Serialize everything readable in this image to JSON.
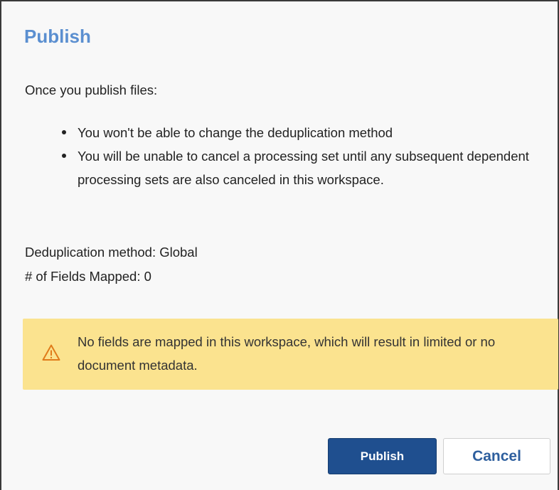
{
  "dialog": {
    "title": "Publish",
    "intro": "Once you publish files:",
    "bullets": [
      "You won't be able to change the deduplication method",
      "You will be unable to cancel a processing set until any subsequent dependent processing sets are also canceled in this workspace."
    ],
    "dedup_line": "Deduplication method: Global",
    "fields_line": "# of Fields Mapped: 0"
  },
  "warning": {
    "icon": "warning-triangle-icon",
    "message": "No fields are mapped in this workspace, which will result in limited or no document metadata.",
    "background": "#fbe38f",
    "icon_color": "#e07b1a"
  },
  "buttons": {
    "publish_label": "Publish",
    "cancel_label": "Cancel"
  },
  "colors": {
    "title": "#5b8fd0",
    "primary_button": "#1f4f8f",
    "cancel_text": "#2e5f9e"
  }
}
